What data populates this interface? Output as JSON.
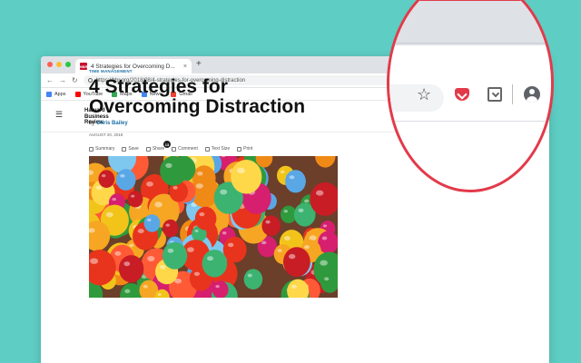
{
  "browser": {
    "tab_title": "4 Strategies for Overcoming D...",
    "tab_close": "×",
    "new_tab": "+",
    "url": "https://hbr.org/2018/08/4-strategies-for-overcoming-distraction",
    "bookmarks": [
      {
        "label": "Apps",
        "color": "#4285f4"
      },
      {
        "label": "YouTube",
        "color": "#ff0000"
      },
      {
        "label": "Maps",
        "color": "#34a853"
      },
      {
        "label": "News",
        "color": "#4285f4"
      },
      {
        "label": "Gmail",
        "color": "#ea4335"
      }
    ]
  },
  "site": {
    "logo_text": "Harvard Business Review",
    "menu_icon": "menu-icon"
  },
  "article": {
    "kicker": "TIME MANAGEMENT",
    "headline": "4 Strategies for Overcoming Distraction",
    "byline_prefix": "by",
    "author": "Chris Bailey",
    "date": "AUGUST 20, 2018",
    "tools": [
      "Summary",
      "Save",
      "Share",
      "Comment",
      "Text Size",
      "Print"
    ],
    "comment_count": "13"
  },
  "colors": {
    "background": "#5ecdc3",
    "accent_red": "#e23a4a",
    "link_blue": "#1b6fa8"
  }
}
